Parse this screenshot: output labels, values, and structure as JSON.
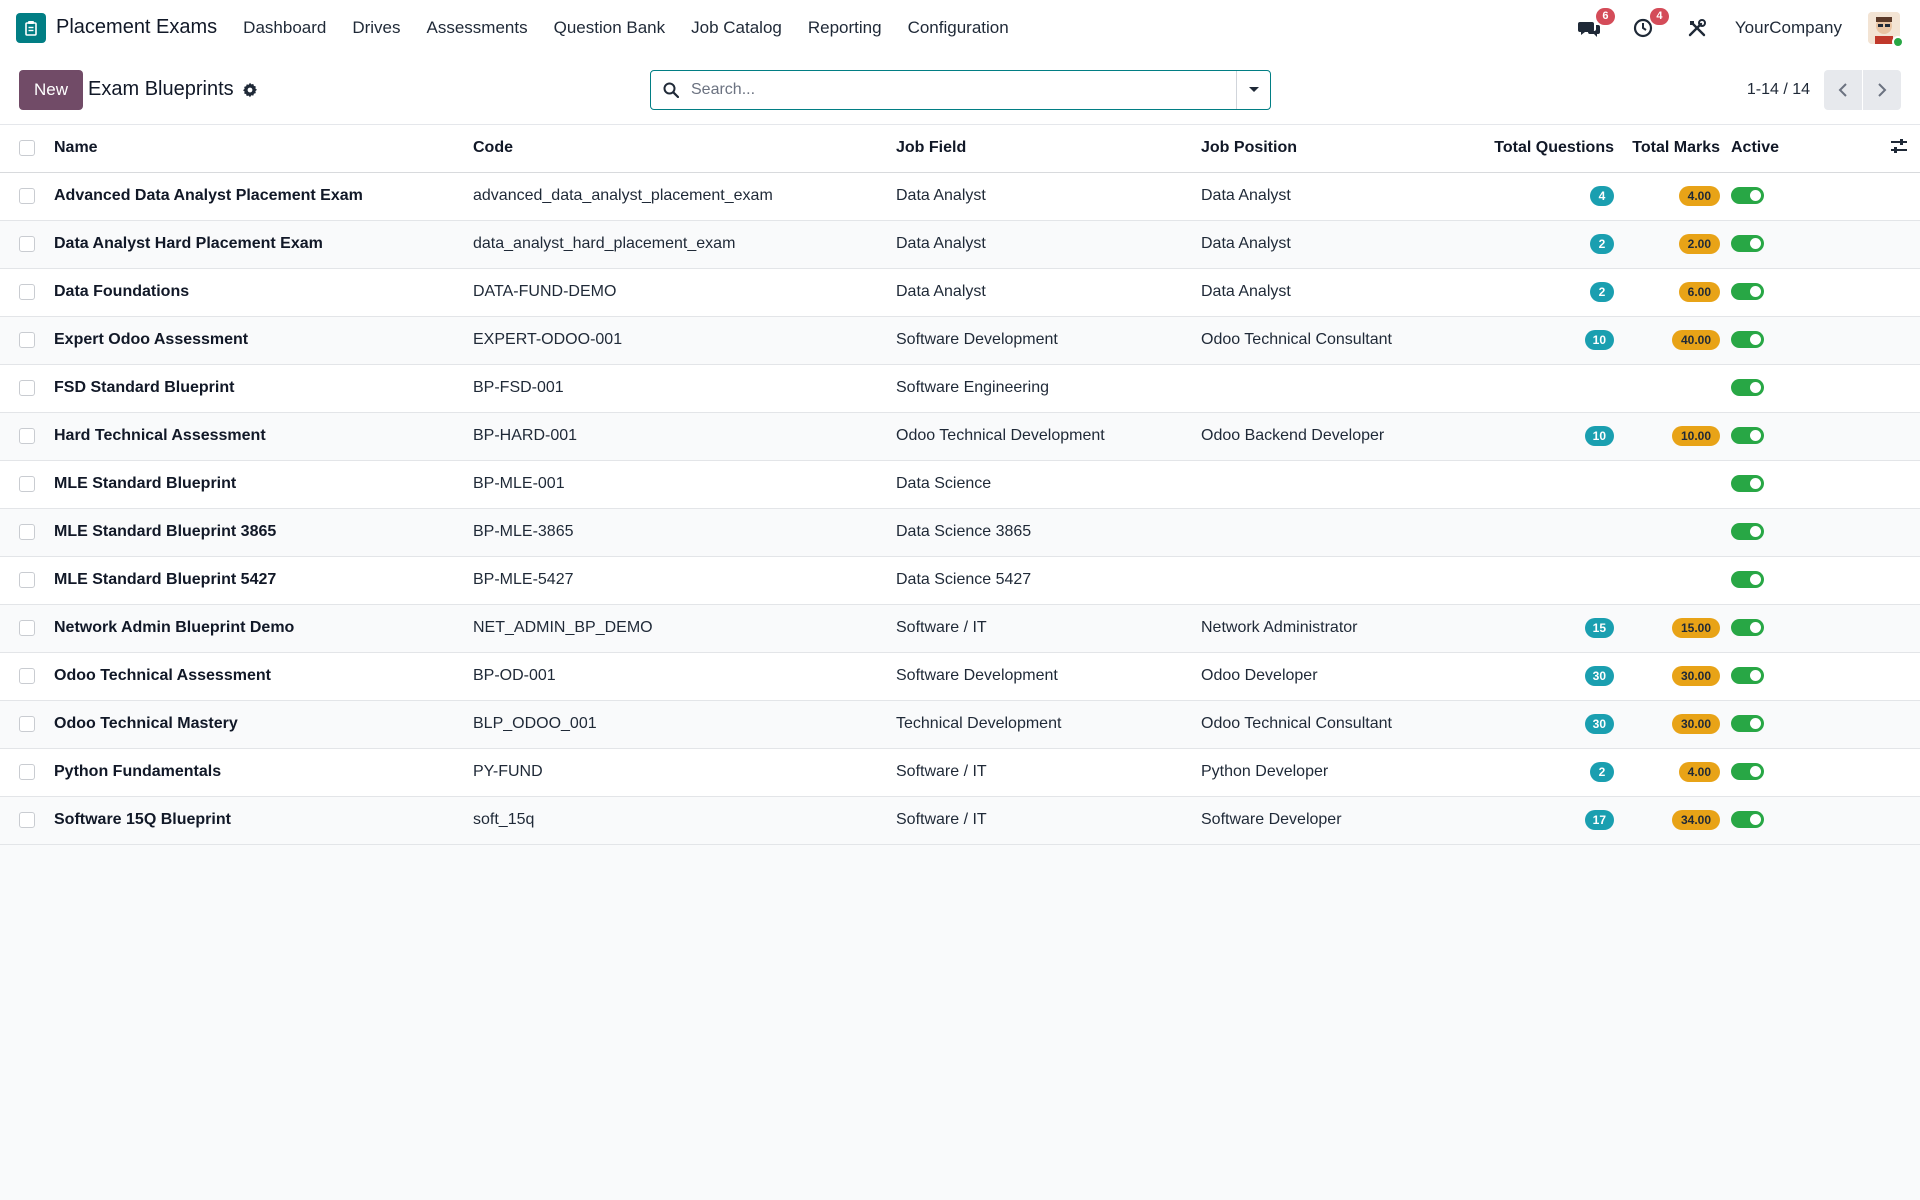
{
  "app": {
    "name": "Placement Exams",
    "icon": "exam-app-icon"
  },
  "menu": [
    "Dashboard",
    "Drives",
    "Assessments",
    "Question Bank",
    "Job Catalog",
    "Reporting",
    "Configuration"
  ],
  "systray": {
    "messages_count": "6",
    "activities_count": "4",
    "company": "YourCompany"
  },
  "control": {
    "new_label": "New",
    "title": "Exam Blueprints",
    "search_placeholder": "Search...",
    "pager": "1-14 / 14"
  },
  "columns": {
    "name": "Name",
    "code": "Code",
    "job_field": "Job Field",
    "job_position": "Job Position",
    "total_questions": "Total Questions",
    "total_marks": "Total Marks",
    "active": "Active"
  },
  "colors": {
    "brand": "#714b67",
    "accent": "#017e84",
    "questions_badge": "#1a9fb0",
    "marks_badge": "#e8a317",
    "toggle_on": "#28a745"
  },
  "rows": [
    {
      "name": "Advanced Data Analyst Placement Exam",
      "code": "advanced_data_analyst_placement_exam",
      "job_field": "Data Analyst",
      "job_position": "Data Analyst",
      "total_questions": "4",
      "total_marks": "4.00",
      "active": true
    },
    {
      "name": "Data Analyst Hard Placement Exam",
      "code": "data_analyst_hard_placement_exam",
      "job_field": "Data Analyst",
      "job_position": "Data Analyst",
      "total_questions": "2",
      "total_marks": "2.00",
      "active": true
    },
    {
      "name": "Data Foundations",
      "code": "DATA-FUND-DEMO",
      "job_field": "Data Analyst",
      "job_position": "Data Analyst",
      "total_questions": "2",
      "total_marks": "6.00",
      "active": true
    },
    {
      "name": "Expert Odoo Assessment",
      "code": "EXPERT-ODOO-001",
      "job_field": "Software Development",
      "job_position": "Odoo Technical Consultant",
      "total_questions": "10",
      "total_marks": "40.00",
      "active": true
    },
    {
      "name": "FSD Standard Blueprint",
      "code": "BP-FSD-001",
      "job_field": "Software Engineering",
      "job_position": "",
      "total_questions": "",
      "total_marks": "",
      "active": true
    },
    {
      "name": "Hard Technical Assessment",
      "code": "BP-HARD-001",
      "job_field": "Odoo Technical Development",
      "job_position": "Odoo Backend Developer",
      "total_questions": "10",
      "total_marks": "10.00",
      "active": true
    },
    {
      "name": "MLE Standard Blueprint",
      "code": "BP-MLE-001",
      "job_field": "Data Science",
      "job_position": "",
      "total_questions": "",
      "total_marks": "",
      "active": true
    },
    {
      "name": "MLE Standard Blueprint 3865",
      "code": "BP-MLE-3865",
      "job_field": "Data Science 3865",
      "job_position": "",
      "total_questions": "",
      "total_marks": "",
      "active": true
    },
    {
      "name": "MLE Standard Blueprint 5427",
      "code": "BP-MLE-5427",
      "job_field": "Data Science 5427",
      "job_position": "",
      "total_questions": "",
      "total_marks": "",
      "active": true
    },
    {
      "name": "Network Admin Blueprint Demo",
      "code": "NET_ADMIN_BP_DEMO",
      "job_field": "Software / IT",
      "job_position": "Network Administrator",
      "total_questions": "15",
      "total_marks": "15.00",
      "active": true
    },
    {
      "name": "Odoo Technical Assessment",
      "code": "BP-OD-001",
      "job_field": "Software Development",
      "job_position": "Odoo Developer",
      "total_questions": "30",
      "total_marks": "30.00",
      "active": true
    },
    {
      "name": "Odoo Technical Mastery",
      "code": "BLP_ODOO_001",
      "job_field": "Technical Development",
      "job_position": "Odoo Technical Consultant",
      "total_questions": "30",
      "total_marks": "30.00",
      "active": true
    },
    {
      "name": "Python Fundamentals",
      "code": "PY-FUND",
      "job_field": "Software / IT",
      "job_position": "Python Developer",
      "total_questions": "2",
      "total_marks": "4.00",
      "active": true
    },
    {
      "name": "Software 15Q Blueprint",
      "code": "soft_15q",
      "job_field": "Software / IT",
      "job_position": "Software Developer",
      "total_questions": "17",
      "total_marks": "34.00",
      "active": true
    }
  ]
}
